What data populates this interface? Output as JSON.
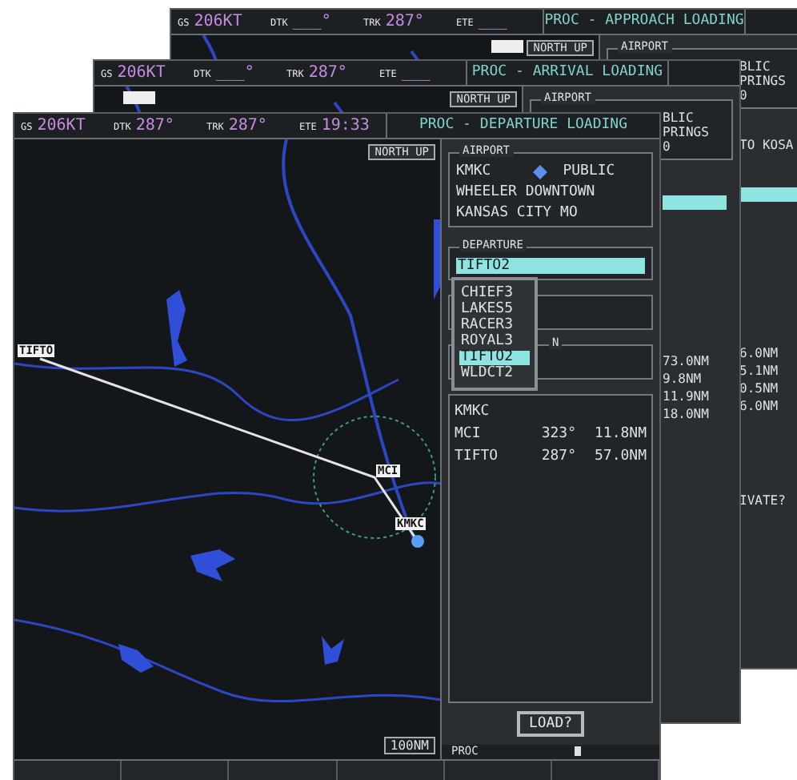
{
  "windows": [
    {
      "kind": "back",
      "nav": [
        {
          "label": "GS",
          "value": "206KT"
        },
        {
          "label": "DTK",
          "value": "___°"
        },
        {
          "label": "TRK",
          "value": "287°"
        },
        {
          "label": "ETE",
          "value": "___"
        }
      ],
      "title": "PROC - APPROACH LOADING",
      "north_up": "NORTH UP",
      "airport_label": "AIRPORT",
      "airport_lines": [
        "BLIC",
        "PRINGS",
        "0"
      ],
      "peek": [
        {
          "kind": "text",
          "text": "TO KOSA"
        },
        {
          "kind": "field"
        },
        {
          "kind": "distance",
          "text": "6.0NM"
        },
        {
          "kind": "distance",
          "text": "5.1NM"
        },
        {
          "kind": "distance",
          "text": "0.5NM"
        },
        {
          "kind": "distance",
          "text": "6.0NM"
        },
        {
          "kind": "prompt",
          "text": "IVATE?"
        }
      ]
    },
    {
      "kind": "back",
      "nav": [
        {
          "label": "GS",
          "value": "206KT"
        },
        {
          "label": "DTK",
          "value": "___°"
        },
        {
          "label": "TRK",
          "value": "287°"
        },
        {
          "label": "ETE",
          "value": "___"
        }
      ],
      "title": "PROC - ARRIVAL LOADING",
      "north_up": "NORTH UP",
      "airport_label": "AIRPORT",
      "airport_lines": [
        "BLIC",
        "PRINGS",
        "0"
      ],
      "peek": [
        {
          "kind": "field"
        },
        {
          "kind": "distance",
          "text": "73.0NM"
        },
        {
          "kind": "distance",
          "text": "9.8NM"
        },
        {
          "kind": "distance",
          "text": "11.9NM"
        },
        {
          "kind": "distance",
          "text": "18.0NM"
        }
      ]
    },
    {
      "kind": "front",
      "nav": [
        {
          "label": "GS",
          "value": "206KT"
        },
        {
          "label": "DTK",
          "value": "287°"
        },
        {
          "label": "TRK",
          "value": "287°"
        },
        {
          "label": "ETE",
          "value": "19:33"
        }
      ],
      "title": "PROC - DEPARTURE LOADING",
      "north_up": "NORTH UP",
      "map": {
        "range": "100NM",
        "waypoints": [
          {
            "text": "TIFTO"
          },
          {
            "text": "MCI"
          },
          {
            "text": "KMKC"
          }
        ]
      },
      "airport": {
        "label": "AIRPORT",
        "ident": "KMKC",
        "type": "PUBLIC",
        "name": "WHEELER DOWNTOWN",
        "city": "KANSAS CITY MO"
      },
      "departure": {
        "label": "DEPARTURE",
        "value": "TIFTO2"
      },
      "departure_list": [
        {
          "text": "CHIEF3",
          "selected": false
        },
        {
          "text": "LAKES5",
          "selected": false
        },
        {
          "text": "RACER3",
          "selected": false
        },
        {
          "text": "ROYAL3",
          "selected": false
        },
        {
          "text": "TIFTO2",
          "selected": true
        },
        {
          "text": "WLDCT2",
          "selected": false
        }
      ],
      "box_label": "N",
      "sequence": [
        {
          "waypoint": "KMKC"
        },
        {
          "waypoint": "MCI",
          "course": "323°",
          "distance": "11.8NM"
        },
        {
          "waypoint": "TIFTO",
          "course": "287°",
          "distance": "57.0NM"
        }
      ],
      "load_button": "LOAD?",
      "footer": "PROC"
    }
  ]
}
